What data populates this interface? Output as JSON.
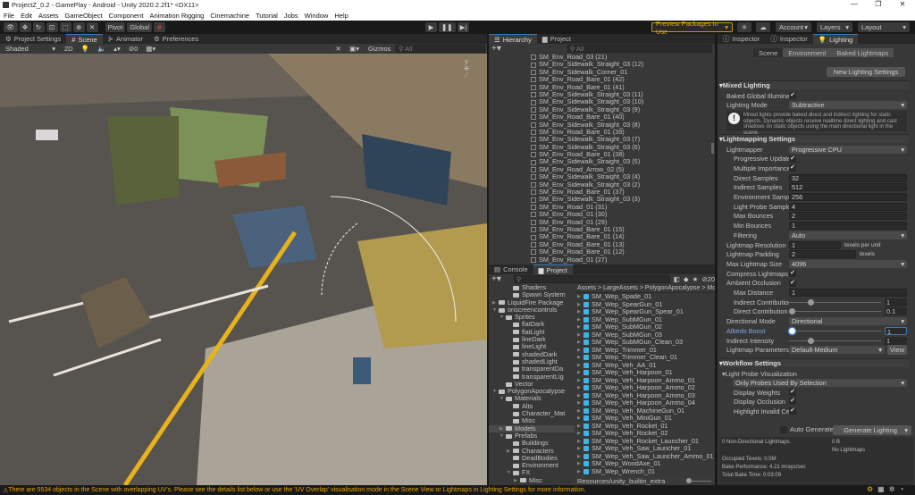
{
  "window": {
    "title": "ProjectZ_0.2 - GamePlay - Android - Unity 2020.2.2f1* <DX11>",
    "min": "—",
    "restore": "❐",
    "close": "✕"
  },
  "menu": [
    "File",
    "Edit",
    "Assets",
    "GameObject",
    "Component",
    "Animation Rigging",
    "Cinemachine",
    "Tutorial",
    "Jobs",
    "Window",
    "Help"
  ],
  "toolbar": {
    "pivot": "Pivot",
    "global": "Global",
    "play": "▶",
    "pause": "❚❚",
    "step": "▶|",
    "preview": "Preview Packages in Use",
    "account": "Account",
    "layers": "Layers",
    "layout": "Layout"
  },
  "scene": {
    "tabs": [
      "Project Settings",
      "Scene",
      "Animator",
      "Preferences"
    ],
    "shading": "Shaded",
    "mode2d": "2D",
    "hidden_count": "0",
    "gizmos": "Gizmos",
    "search_placeholder": "All"
  },
  "hierarchy": {
    "tabs": [
      "Hierarchy",
      "Project"
    ],
    "search_placeholder": "All",
    "items": [
      "SM_Env_Road_03 (21)",
      "SM_Env_Sidewalk_Straight_03 (12)",
      "SM_Env_Sidewalk_Corner_01",
      "SM_Env_Road_Bare_01 (42)",
      "SM_Env_Road_Bare_01 (41)",
      "SM_Env_Sidewalk_Straight_03 (11)",
      "SM_Env_Sidewalk_Straight_03 (10)",
      "SM_Env_Sidewalk_Straight_03 (9)",
      "SM_Env_Road_Bare_01 (40)",
      "SM_Env_Sidewalk_Straight_03 (8)",
      "SM_Env_Road_Bare_01 (39)",
      "SM_Env_Sidewalk_Straight_03 (7)",
      "SM_Env_Sidewalk_Straight_03 (6)",
      "SM_Env_Road_Bare_01 (38)",
      "SM_Env_Sidewalk_Straight_03 (5)",
      "SM_Env_Road_Arrow_02 (5)",
      "SM_Env_Sidewalk_Straight_03 (4)",
      "SM_Env_Sidewalk_Straight_03 (2)",
      "SM_Env_Road_Bare_01 (37)",
      "SM_Env_Sidewalk_Straight_03 (3)",
      "SM_Env_Road_01 (31)",
      "SM_Env_Road_01 (30)",
      "SM_Env_Road_01 (29)",
      "SM_Env_Road_Bare_01 (15)",
      "SM_Env_Road_Bare_01 (14)",
      "SM_Env_Road_Bare_01 (13)",
      "SM_Env_Road_Bare_01 (12)",
      "SM_Env_Road_01 (27)"
    ]
  },
  "project": {
    "tabs": [
      "Console",
      "Project"
    ],
    "hidden_count": "20",
    "tree": [
      {
        "l": "Shaders",
        "d": 4
      },
      {
        "l": "Spawn System",
        "d": 4
      },
      {
        "l": "LiquidFire Package",
        "d": 2,
        "a": "▶"
      },
      {
        "l": "onscreencontrols",
        "d": 2,
        "a": "▼"
      },
      {
        "l": "Sprites",
        "d": 3,
        "a": "▼"
      },
      {
        "l": "flatDark",
        "d": 4
      },
      {
        "l": "flatLight",
        "d": 4
      },
      {
        "l": "lineDark",
        "d": 4
      },
      {
        "l": "lineLight",
        "d": 4
      },
      {
        "l": "shadedDark",
        "d": 4
      },
      {
        "l": "shadedLight",
        "d": 4
      },
      {
        "l": "transparentDa",
        "d": 4
      },
      {
        "l": "transparentLig",
        "d": 4
      },
      {
        "l": "Vector",
        "d": 3
      },
      {
        "l": "PolygonApocalypse",
        "d": 2,
        "a": "▼"
      },
      {
        "l": "Materials",
        "d": 3,
        "a": "▼"
      },
      {
        "l": "Alts",
        "d": 4
      },
      {
        "l": "Character_Mat",
        "d": 4
      },
      {
        "l": "Misc",
        "d": 4
      },
      {
        "l": "Models",
        "d": 3,
        "a": "▶",
        "sel": true
      },
      {
        "l": "Prefabs",
        "d": 3,
        "a": "▼"
      },
      {
        "l": "Buildings",
        "d": 4
      },
      {
        "l": "Characters",
        "d": 4,
        "a": "▶"
      },
      {
        "l": "DeadBodies",
        "d": 4
      },
      {
        "l": "Environment",
        "d": 4
      },
      {
        "l": "FX",
        "d": 4,
        "a": "▼"
      },
      {
        "l": "Misc",
        "d": 5,
        "a": "▶"
      }
    ],
    "breadcrumb": [
      "Assets",
      "LargeAssets",
      "PolygonApocalypse",
      "Mo"
    ],
    "files": [
      "SM_Wep_Spade_01",
      "SM_Wep_SpearGun_01",
      "SM_Wep_SpearGun_Spear_01",
      "SM_Wep_SubMGun_01",
      "SM_Wep_SubMGun_02",
      "SM_Wep_SubMGun_03",
      "SM_Wep_SubMGun_Clean_03",
      "SM_Wep_Trimmer_01",
      "SM_Wep_Trimmer_Clean_01",
      "SM_Wep_Veh_AA_01",
      "SM_Wep_Veh_Harpoon_01",
      "SM_Wep_Veh_Harpoon_Ammo_01",
      "SM_Wep_Veh_Harpoon_Ammo_02",
      "SM_Wep_Veh_Harpoon_Ammo_03",
      "SM_Wep_Veh_Harpoon_Ammo_04",
      "SM_Wep_Veh_MachineGun_01",
      "SM_Wep_Veh_MiniGun_01",
      "SM_Wep_Veh_Rocket_01",
      "SM_Wep_Veh_Rocket_02",
      "SM_Wep_Veh_Rocket_Launcher_01",
      "SM_Wep_Veh_Saw_Launcher_01",
      "SM_Wep_Veh_Saw_Launcher_Ammo_01",
      "SM_Wep_WoodAxe_01",
      "SM_Wep_Wrench_01"
    ],
    "footer_path": "Resources/unity_builtin_extra"
  },
  "lighting": {
    "tabs": [
      "Inspector",
      "Inspector",
      "Lighting"
    ],
    "subtabs": [
      "Scene",
      "Environment",
      "Baked Lightmaps"
    ],
    "new_settings": "New Lighting Settings",
    "mixed_header": "Mixed Lighting",
    "baked_gi": "Baked Global Illuminat",
    "lighting_mode_label": "Lighting Mode",
    "lighting_mode": "Subtractive",
    "help": "Mixed lights provide baked direct and indirect lighting for static objects. Dynamic objects receive realtime direct lighting and cast shadows on static objects using the main directional light in the scene.",
    "lm_header": "Lightmapping Settings",
    "lightmapper_label": "Lightmapper",
    "lightmapper": "Progressive CPU",
    "prog_update": "Progressive Update",
    "mis": "Multiple Importance",
    "direct_samples_label": "Direct Samples",
    "direct_samples": "32",
    "indirect_samples_label": "Indirect Samples",
    "indirect_samples": "512",
    "env_samples_label": "Environment Sample",
    "env_samples": "256",
    "lp_samples_label": "Light Probe Sample",
    "lp_samples": "4",
    "max_bounces_label": "Max Bounces",
    "max_bounces": "2",
    "min_bounces_label": "Min Bounces",
    "min_bounces": "1",
    "filtering_label": "Filtering",
    "filtering": "Auto",
    "resolution_label": "Lightmap Resolution",
    "resolution": "1",
    "resolution_unit": "texels per unit",
    "padding_label": "Lightmap Padding",
    "padding": "2",
    "padding_unit": "texels",
    "max_size_label": "Max Lightmap Size",
    "max_size": "4096",
    "compress": "Compress Lightmaps",
    "ao": "Ambient Occlusion",
    "max_distance_label": "Max Distance",
    "max_distance": "1",
    "indirect_contrib_label": "Indirect Contribution",
    "indirect_contrib": "1",
    "direct_contrib_label": "Direct Contribution",
    "direct_contrib": "0.1",
    "dir_mode_label": "Directional Mode",
    "dir_mode": "Directional",
    "albedo_label": "Albedo Boost",
    "albedo": "1",
    "indirect_intensity_label": "Indirect Intensity",
    "indirect_intensity": "1",
    "params_label": "Lightmap Parameters",
    "params": "Default-Medium",
    "view": "View",
    "wf_header": "Workflow Settings",
    "lpv_label": "Light Probe Visualization",
    "lpv": "Only Probes Used By Selection",
    "weights": "Display Weights",
    "occlusion": "Display Occlusion",
    "highlight": "Highlight Invalid Ce",
    "auto_generate": "Auto Generate",
    "generate": "Generate Lighting",
    "stats": {
      "nondir": "0 Non-Directional Lightmaps",
      "size": "0 B",
      "none": "No Lightmaps",
      "texels": "Occupied Texels: 0.5M",
      "perf": "Bake Performance: 4.21 mrays/sec",
      "time": "Total Bake Time: 0:03:09"
    }
  },
  "status": {
    "message": "There are 5534 objects in the Scene with overlapping UV's. Please see the details list below or use the 'UV Overlap' visualisation mode in the Scene View or Lightmaps in Lighting Settings for more information."
  },
  "colors": {
    "accent": "#3a79bb",
    "warning": "#e8a800",
    "road": "#5a5550",
    "line": "#e8b21c"
  }
}
